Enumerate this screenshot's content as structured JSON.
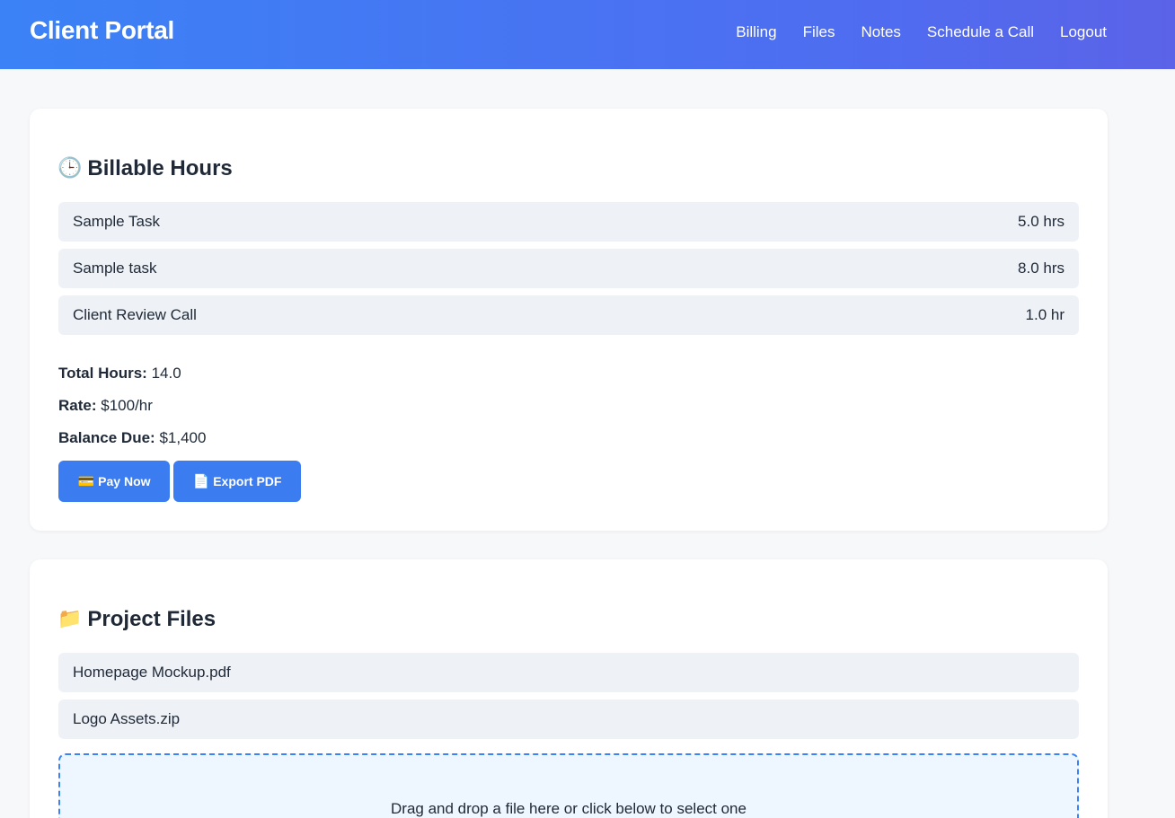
{
  "header": {
    "title": "Client Portal",
    "nav": [
      "Billing",
      "Files",
      "Notes",
      "Schedule a Call",
      "Logout"
    ]
  },
  "billing": {
    "icon": "🕒",
    "icon_name": "clock-icon",
    "title": "Billable Hours",
    "tasks": [
      {
        "name": "Sample Task",
        "hours": "5.0 hrs"
      },
      {
        "name": "Sample task",
        "hours": "8.0 hrs"
      },
      {
        "name": "Client Review Call",
        "hours": "1.0 hr"
      }
    ],
    "total_label": "Total Hours:",
    "total_value": "14.0",
    "rate_label": "Rate:",
    "rate_value": "$100/hr",
    "balance_label": "Balance Due:",
    "balance_value": "$1,400",
    "pay_icon": "💳",
    "pay_label": "Pay Now",
    "export_icon": "📄",
    "export_label": "Export PDF"
  },
  "files": {
    "icon": "📁",
    "icon_name": "folder-icon",
    "title": "Project Files",
    "items": [
      "Homepage Mockup.pdf",
      "Logo Assets.zip"
    ],
    "dropzone_text": "Drag and drop a file here or click below to select one"
  },
  "colors": {
    "accent": "#3b7cf0",
    "header_gradient_start": "#3b82f6",
    "header_gradient_end": "#5b63e8",
    "row_bg": "#eef2f7",
    "page_bg": "#f7f8fa"
  }
}
